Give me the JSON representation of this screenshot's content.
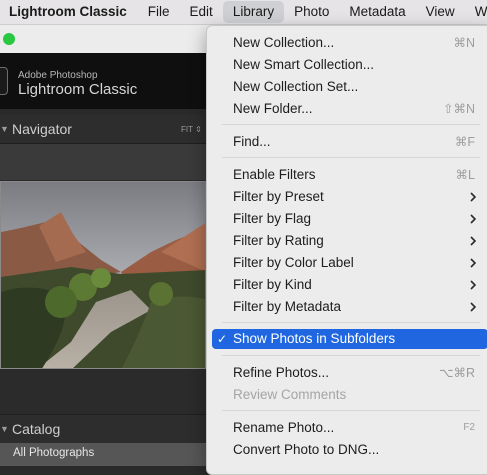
{
  "menubar": {
    "app": "Lightroom Classic",
    "items": [
      "File",
      "Edit",
      "Library",
      "Photo",
      "Metadata",
      "View",
      "W"
    ]
  },
  "identity": {
    "brand_top": "Adobe Photoshop",
    "brand_main": "Lightroom Classic"
  },
  "navigator": {
    "title": "Navigator",
    "fit": "FIT"
  },
  "catalog": {
    "title": "Catalog",
    "item": "All Photographs"
  },
  "library_menu": {
    "new_collection": {
      "label": "New Collection...",
      "shortcut": "⌘N"
    },
    "new_smart_collection": {
      "label": "New Smart Collection..."
    },
    "new_collection_set": {
      "label": "New Collection Set..."
    },
    "new_folder": {
      "label": "New Folder...",
      "shortcut": "⇧⌘N"
    },
    "find": {
      "label": "Find...",
      "shortcut": "⌘F"
    },
    "enable_filters": {
      "label": "Enable Filters",
      "shortcut": "⌘L"
    },
    "filter_by_preset": {
      "label": "Filter by Preset"
    },
    "filter_by_flag": {
      "label": "Filter by Flag"
    },
    "filter_by_rating": {
      "label": "Filter by Rating"
    },
    "filter_by_color_label": {
      "label": "Filter by Color Label"
    },
    "filter_by_kind": {
      "label": "Filter by Kind"
    },
    "filter_by_metadata": {
      "label": "Filter by Metadata"
    },
    "show_photos_in_subfolders": {
      "label": "Show Photos in Subfolders",
      "checked": true
    },
    "refine_photos": {
      "label": "Refine Photos...",
      "shortcut": "⌥⌘R"
    },
    "review_comments": {
      "label": "Review Comments",
      "disabled": true
    },
    "rename_photo": {
      "label": "Rename Photo...",
      "shortcut": "F2"
    },
    "convert_photo_to_dng": {
      "label": "Convert Photo to DNG..."
    }
  },
  "colors": {
    "selection": "#1f66e0",
    "menu_bg": "#ececed",
    "traffic_green": "#28c840"
  }
}
